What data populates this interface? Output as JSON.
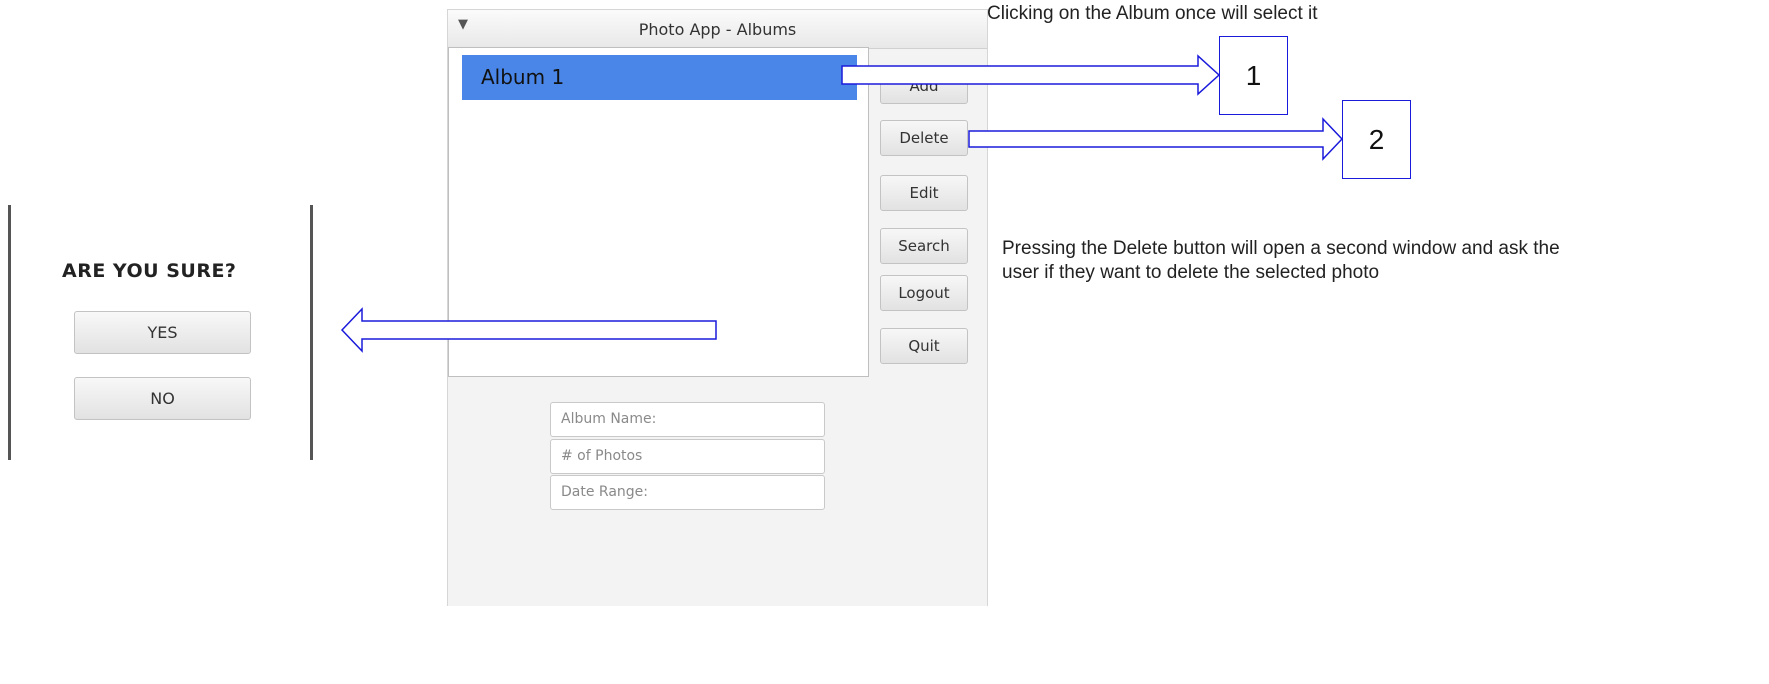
{
  "window": {
    "title": "Photo App - Albums",
    "menu_glyph": "▼"
  },
  "albums": [
    {
      "name": "Album 1",
      "selected": true
    }
  ],
  "side_buttons": {
    "add": "Add",
    "delete": "Delete",
    "edit": "Edit",
    "search": "Search",
    "logout": "Logout",
    "quit": "Quit"
  },
  "fields": {
    "album_name": "Album Name:",
    "num_photos": "# of Photos",
    "date_range": "Date Range:"
  },
  "dialog": {
    "title": "ARE YOU SURE?",
    "yes": "YES",
    "no": "NO"
  },
  "annotations": {
    "note_select": "Clicking on the Album once will select it",
    "note_delete": "Pressing the Delete button will open a second window and ask the user if they want to delete the selected photo",
    "step1": "1",
    "step2": "2"
  },
  "colors": {
    "selection": "#4a86e8",
    "arrow_stroke": "#1a1adb"
  }
}
